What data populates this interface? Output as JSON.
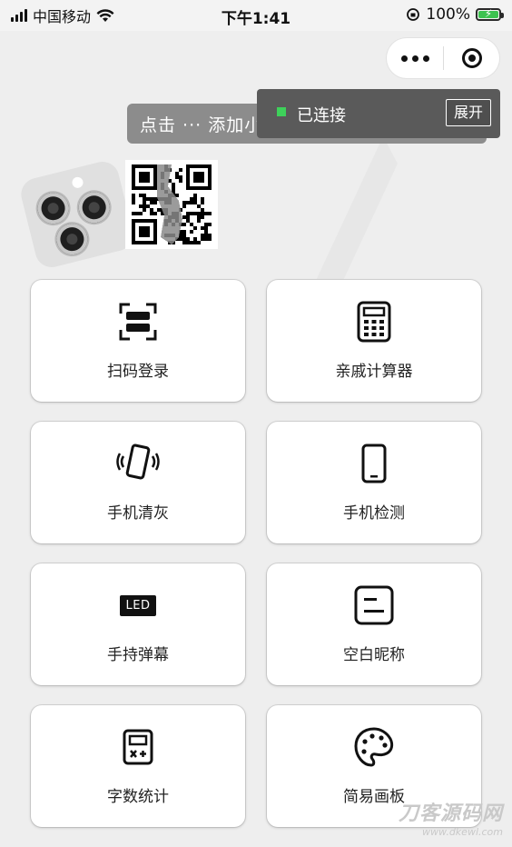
{
  "status_bar": {
    "carrier": "中国移动",
    "time": "下午1:41",
    "battery": "100%",
    "battery_level": 1.0
  },
  "capsule": {
    "more_icon": "more-dots-icon",
    "close_icon": "target-icon"
  },
  "tip": {
    "text": "点击 ··· 添加小程序，下次访问更方便"
  },
  "connection": {
    "status": "已连接",
    "expand_label": "展开",
    "dot_color": "#3ed15a"
  },
  "header": {
    "phone_icon": "phone-camera-illustration",
    "qr_icon": "qr-code"
  },
  "features": [
    {
      "label": "扫码登录",
      "icon": "scan-icon"
    },
    {
      "label": "亲戚计算器",
      "icon": "calculator-icon"
    },
    {
      "label": "手机清灰",
      "icon": "phone-vibrate-icon"
    },
    {
      "label": "手机检测",
      "icon": "phone-icon"
    },
    {
      "label": "手持弹幕",
      "icon": "led-icon",
      "icon_text": "LED"
    },
    {
      "label": "空白昵称",
      "icon": "blank-name-icon"
    },
    {
      "label": "字数统计",
      "icon": "word-count-icon"
    },
    {
      "label": "简易画板",
      "icon": "palette-icon"
    }
  ],
  "watermark": {
    "title": "刀客源码网",
    "url": "www.dkewl.com"
  }
}
